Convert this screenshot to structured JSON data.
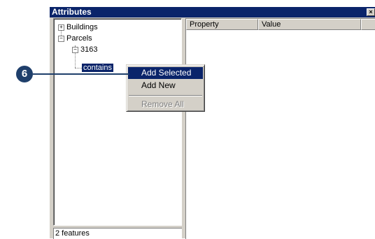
{
  "window": {
    "title": "Attributes",
    "close_glyph": "×"
  },
  "tree": {
    "items": [
      {
        "label": "Buildings",
        "expander": "+"
      },
      {
        "label": "Parcels",
        "expander": "−"
      },
      {
        "label": "3163",
        "expander": "−"
      },
      {
        "label": "contains"
      }
    ]
  },
  "status": {
    "text": "2 features"
  },
  "grid": {
    "columns": [
      "Property",
      "Value"
    ]
  },
  "context_menu": {
    "items": [
      "Add Selected",
      "Add New",
      "Remove All"
    ],
    "highlighted": "Add Selected",
    "disabled": [
      "Remove All"
    ]
  },
  "callout": {
    "number": "6"
  },
  "colors": {
    "selection": "#0a246a",
    "callout": "#1f3f6b",
    "face": "#d4d0c8"
  }
}
